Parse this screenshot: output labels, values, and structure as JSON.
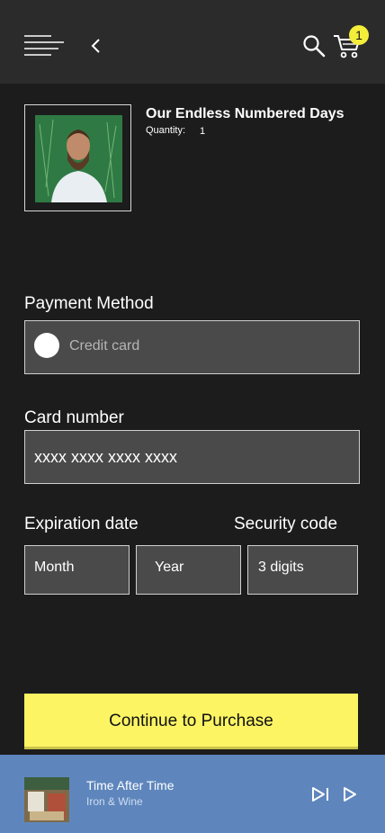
{
  "header": {
    "cart_count": "1",
    "icons": [
      "menu-icon",
      "chevron-left-icon",
      "search-icon",
      "cart-icon"
    ]
  },
  "product": {
    "title": "Our Endless Numbered Days",
    "quantity_label": "Quantity:",
    "quantity": "1"
  },
  "payment": {
    "label": "Payment Method",
    "method_placeholder": "Credit card"
  },
  "card": {
    "label": "Card number",
    "value": "xxxx xxxx xxxx xxxx"
  },
  "expiration": {
    "label": "Expiration date",
    "month_placeholder": "Month",
    "year_placeholder": "Year"
  },
  "security": {
    "label": "Security code",
    "placeholder": "3 digits"
  },
  "cta": {
    "label": "Continue to Purchase"
  },
  "player": {
    "title": "Time After Time",
    "artist": "Iron & Wine",
    "icons": [
      "skip-next-icon",
      "play-icon"
    ]
  },
  "colors": {
    "background": "#1c1c1c",
    "topbar": "#2b2b2b",
    "field": "#4a4a4a",
    "accent": "#fcf463",
    "badge": "#f4ee3a",
    "player": "#5e86bd"
  }
}
